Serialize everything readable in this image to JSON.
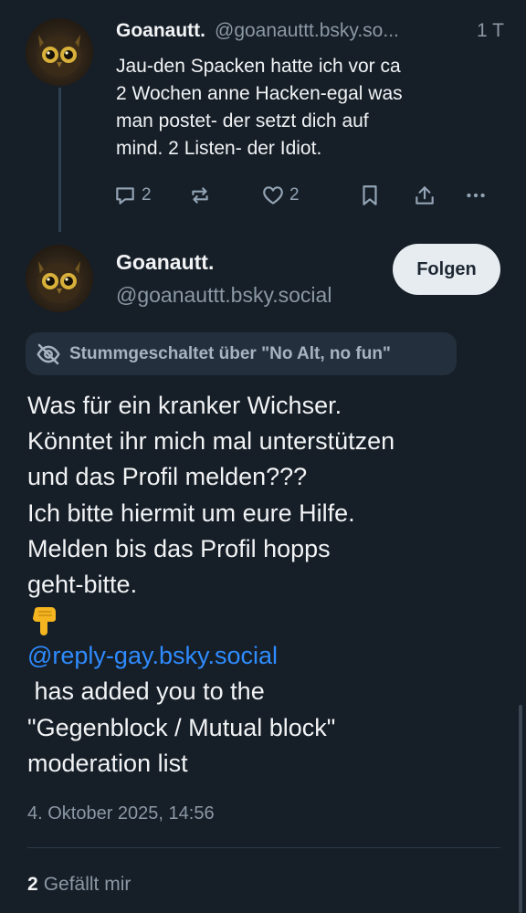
{
  "parent_post": {
    "author_name": "Goanautt.",
    "handle": "@goanauttt.bsky.so...",
    "time": "1 T",
    "text_lines": [
      "Jau-den Spacken hatte ich vor ca",
      "2 Wochen anne Hacken-egal was",
      "man postet- der setzt dich auf",
      "mind. 2 Listen- der Idiot."
    ],
    "reply_count": "2",
    "like_count": "2",
    "icons": [
      "reply-icon",
      "repost-icon",
      "like-icon",
      "bookmark-icon",
      "share-icon",
      "more-icon"
    ]
  },
  "main_post": {
    "author_name": "Goanautt.",
    "handle": "@goanauttt.bsky.social",
    "follow_label": "Folgen",
    "mute_label": "Stummgeschaltet über \"No Alt, no fun\"",
    "text_lines": [
      "Was für ein kranker Wichser.",
      "Könntet ihr mich mal unterstützen",
      "und das Profil melden???",
      "Ich bitte hiermit um eure Hilfe.",
      "Melden bis das Profil hopps",
      "geht-bitte."
    ],
    "emoji": "pointing-down-hand-emoji",
    "mention": "@reply-gay.bsky.social",
    "text_after_lines": [
      " has added you to the",
      "\"Gegenblock / Mutual block\"",
      "moderation list"
    ],
    "date": "4. Oktober 2025, 14:56",
    "like_count": "2",
    "like_label": "Gefällt mir"
  },
  "colors": {
    "background": "#161e27",
    "text": "#f1f3f5",
    "muted": "#8b98a5",
    "link": "#2e8cff",
    "follow_button_bg": "#e7ecf1"
  }
}
